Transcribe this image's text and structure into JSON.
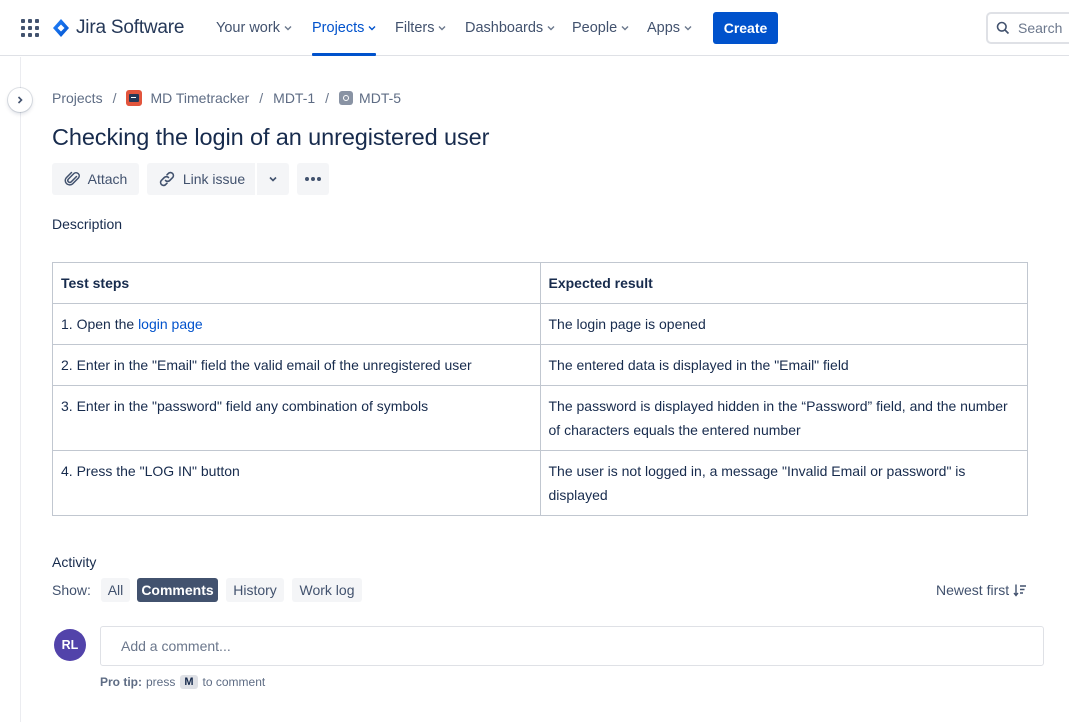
{
  "nav": {
    "product_name": "Jira Software",
    "items": [
      {
        "label": "Your work"
      },
      {
        "label": "Projects"
      },
      {
        "label": "Filters"
      },
      {
        "label": "Dashboards"
      },
      {
        "label": "People"
      },
      {
        "label": "Apps"
      }
    ],
    "active_item": "Projects",
    "create_label": "Create",
    "search_placeholder": "Search"
  },
  "breadcrumb": {
    "items": [
      "Projects",
      "MD Timetracker",
      "MDT-1",
      "MDT-5"
    ],
    "separator": "/"
  },
  "issue": {
    "title": "Checking the login of an unregistered user",
    "actions": {
      "attach_label": "Attach",
      "link_issue_label": "Link issue"
    }
  },
  "description": {
    "label": "Description",
    "table": {
      "headers": [
        "Test steps",
        "Expected result"
      ],
      "rows": [
        {
          "step_prefix": "1. Open the ",
          "step_link": "login page",
          "result": "The login page is opened"
        },
        {
          "step": "2. Enter in the \"Email\" field the valid email of the unregistered user",
          "result": "The entered data is displayed in the \"Email\" field"
        },
        {
          "step": "3. Enter in the \"password\" field any combination of symbols",
          "result": "The password is displayed hidden in the “Password” field, and the number of characters equals the entered number"
        },
        {
          "step": "4. Press the \"LOG IN\" button",
          "result": "The user is not logged in, a message \"Invalid Email or password\" is displayed"
        }
      ]
    }
  },
  "activity": {
    "label": "Activity",
    "show_label": "Show:",
    "filters": [
      "All",
      "Comments",
      "History",
      "Work log"
    ],
    "selected_filter": "Comments",
    "sort_label": "Newest first",
    "avatar_initials": "RL",
    "comment_placeholder": "Add a comment...",
    "pro_tip_label": "Pro tip:",
    "pro_tip_press": "press",
    "pro_tip_key": "M",
    "pro_tip_suffix": "to comment"
  },
  "colors": {
    "brand": "#0052cc",
    "text": "#172b4d",
    "subtle_text": "#42526e",
    "avatar_bg": "#5243aa",
    "project_icon": "#e2553d"
  }
}
